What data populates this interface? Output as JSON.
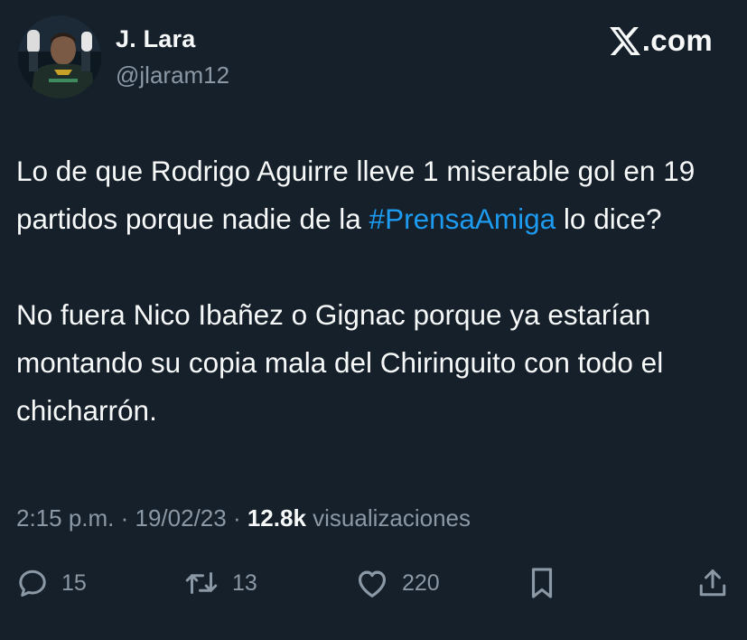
{
  "author": {
    "name": "J. Lara",
    "handle": "@jlaram12",
    "avatar": "avatar-goalkeeper-photo"
  },
  "brand": {
    "logo": "x-logo-icon",
    "text": ".com"
  },
  "tweet": {
    "paragraph1": {
      "before": "Lo de que Rodrigo Aguirre lleve 1 miserable gol en 19 partidos porque nadie de la ",
      "hashtag": "#PrensaAmiga",
      "after": " lo dice?"
    },
    "paragraph2": "No fuera Nico Ibañez o Gignac porque ya estarían montando su copia mala del Chiringuito con todo el chicharrón."
  },
  "meta": {
    "time": "2:15 p.m.",
    "sep1": " · ",
    "date": "19/02/23",
    "sep2": " · ",
    "views_count": "12.8k",
    "views_label": " visualizaciones"
  },
  "actions": {
    "replies": "15",
    "retweets": "13",
    "likes": "220"
  },
  "colors": {
    "background": "#15202b",
    "text": "#f7f9f9",
    "secondary": "#8b98a5",
    "hashtag": "#1d9bf0"
  }
}
